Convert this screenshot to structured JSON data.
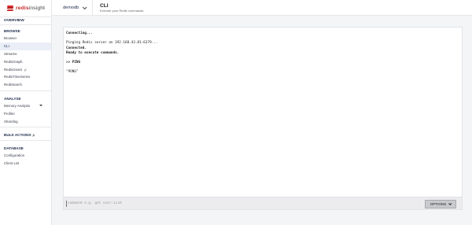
{
  "brand": {
    "name_bold": "redis",
    "name_rest": "insight"
  },
  "sidebar": {
    "overview": "OVERVIEW",
    "browse": {
      "title": "BROWSE",
      "items": [
        "Browser",
        "CLI",
        "Streams",
        "RedisGraph",
        "RedisGears",
        "RedisTimeSeries",
        "RediSearch"
      ],
      "gears_beta": "β"
    },
    "analyse": {
      "title": "ANALYSE",
      "items": [
        "Memory Analysis",
        "Profiler",
        "Sharding"
      ]
    },
    "bulk_actions": {
      "title": "BULK ACTIONS",
      "beta": "β"
    },
    "database": {
      "title": "DATABASE",
      "items": [
        "Configuration",
        "Client List"
      ]
    }
  },
  "header": {
    "database": "demodb",
    "page_title": "CLI",
    "page_subtitle": "Execute your Redis commands"
  },
  "cli": {
    "lines": [
      "Connecting...",
      "Pinging Redis server on 192.168.43.81:6379...",
      "Connected.",
      "Ready to execute commands.",
      ">> PING",
      "\"PONG\""
    ],
    "input_placeholder": "command e.g. get user:1234",
    "options_label": "OPTIONS"
  }
}
